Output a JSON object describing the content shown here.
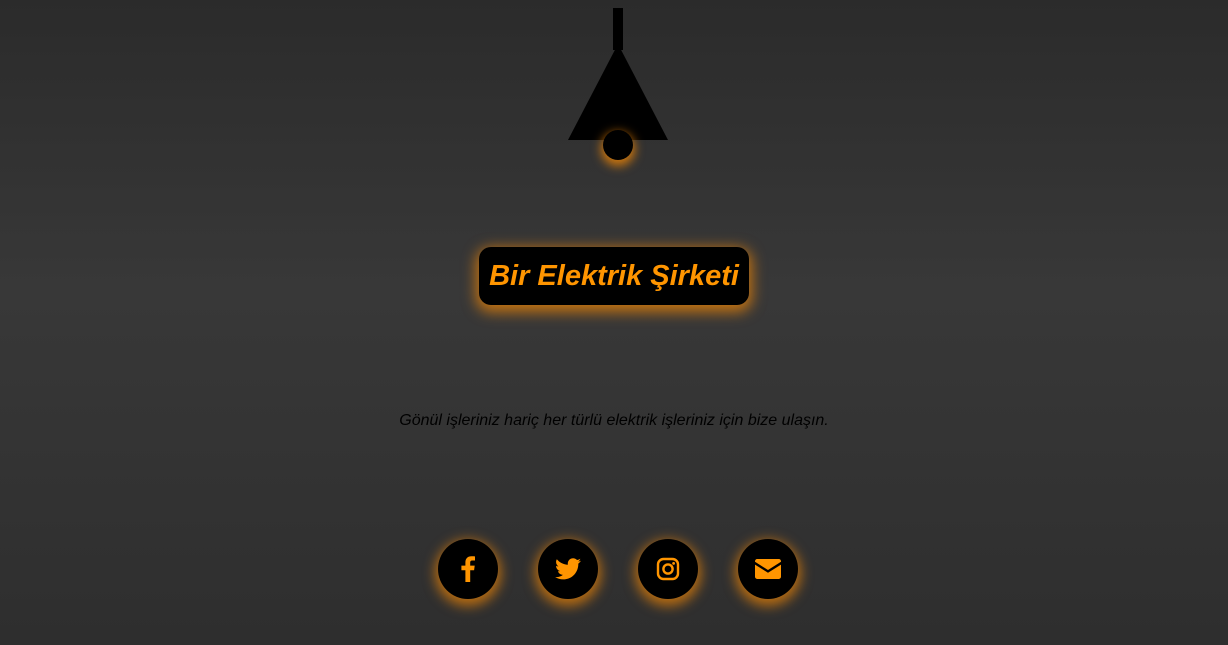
{
  "header": {
    "title": "Bir Elektrik Şirketi"
  },
  "main": {
    "tagline": "Gönül işleriniz hariç her türlü elektrik işleriniz için bize ulaşın."
  },
  "social_links": [
    {
      "name": "facebook",
      "icon": "facebook-icon"
    },
    {
      "name": "twitter",
      "icon": "twitter-icon"
    },
    {
      "name": "instagram",
      "icon": "instagram-icon"
    },
    {
      "name": "email",
      "icon": "envelope-icon"
    }
  ],
  "colors": {
    "accent": "#ff9500",
    "glow": "#ff8c00",
    "background": "#333333",
    "dark": "#000000"
  }
}
